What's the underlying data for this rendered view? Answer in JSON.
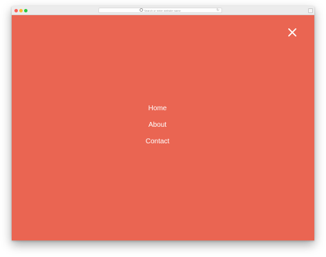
{
  "browser": {
    "address_placeholder": "Search or enter website name"
  },
  "menu": {
    "background_color": "#ea6552",
    "items": [
      {
        "label": "Home"
      },
      {
        "label": "About"
      },
      {
        "label": "Contact"
      }
    ],
    "close_icon": "close-icon"
  }
}
